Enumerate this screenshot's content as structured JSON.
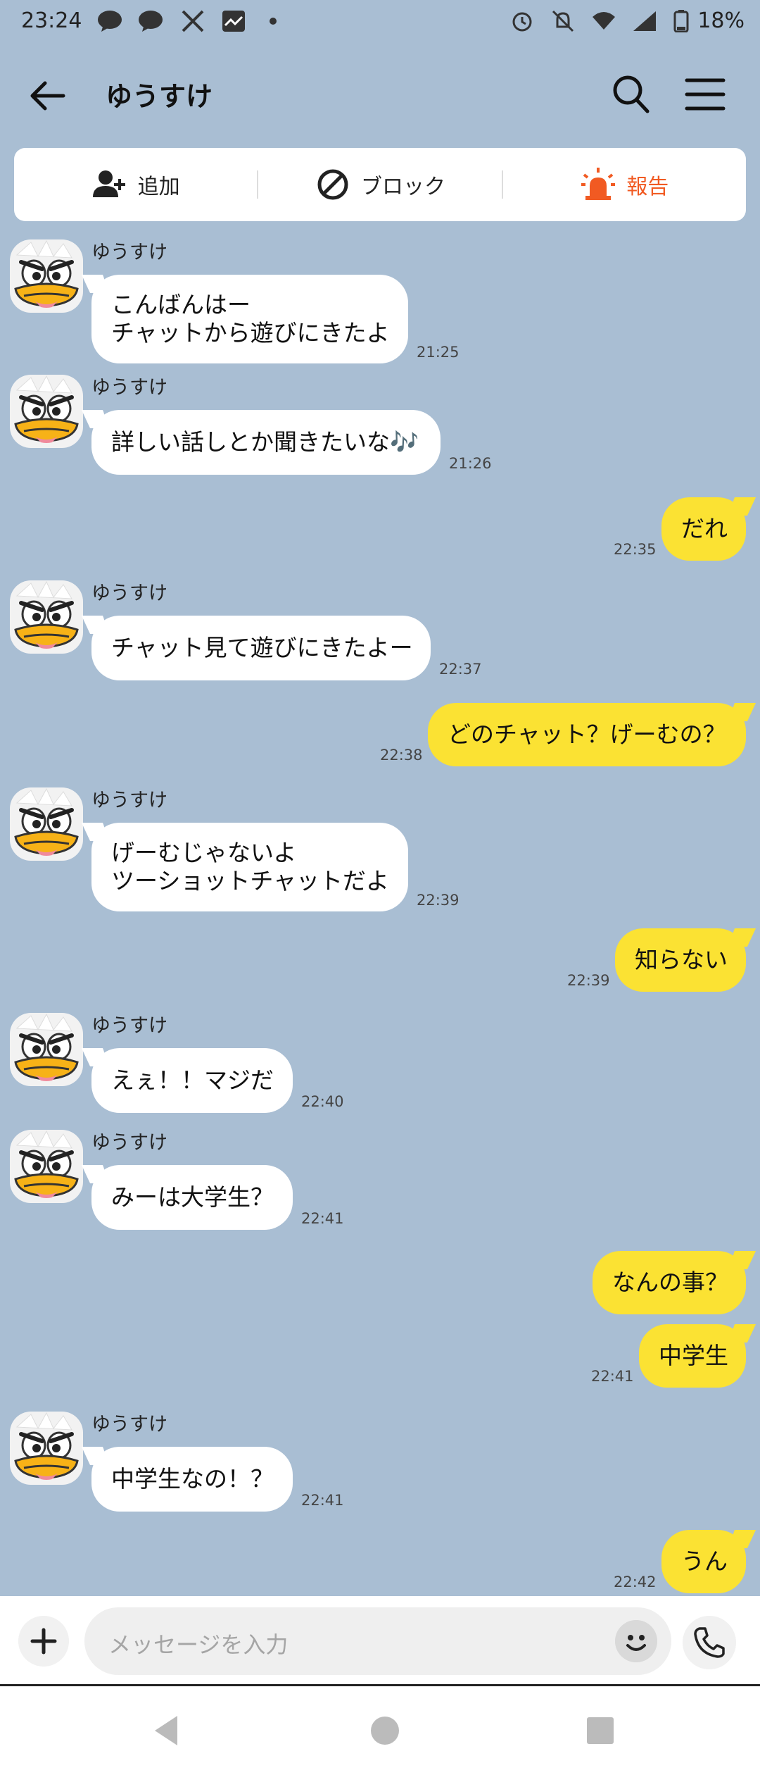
{
  "status_bar": {
    "time": "23:24",
    "notifications": [
      "talk-icon",
      "talk-icon",
      "x-icon",
      "gallery-icon",
      "dot-icon"
    ],
    "battery": "18%"
  },
  "header": {
    "title": "ゆうすけ"
  },
  "actions": {
    "add": "追加",
    "block": "ブロック",
    "report": "報告"
  },
  "messages": [
    {
      "side": "in",
      "sender": "ゆうすけ",
      "text": "こんばんはー\nチャットから遊びにきたよ",
      "time": "21:25"
    },
    {
      "side": "in",
      "sender": "ゆうすけ",
      "text": "詳しい話しとか聞きたいな🎶",
      "time": "21:26"
    },
    {
      "side": "out",
      "text": "だれ",
      "time": "22:35"
    },
    {
      "side": "in",
      "sender": "ゆうすけ",
      "text": "チャット見て遊びにきたよー",
      "time": "22:37"
    },
    {
      "side": "out",
      "text": "どのチャット？げーむの？",
      "time": "22:38"
    },
    {
      "side": "in",
      "sender": "ゆうすけ",
      "text": "げーむじゃないよ\nツーショットチャットだよ",
      "time": "22:39"
    },
    {
      "side": "out",
      "text": "知らない",
      "time": "22:39"
    },
    {
      "side": "in",
      "sender": "ゆうすけ",
      "text": "えぇ！！マジだ",
      "time": "22:40"
    },
    {
      "side": "in",
      "sender": "ゆうすけ",
      "text": "みーは大学生？",
      "time": "22:41"
    },
    {
      "side": "out",
      "text": "なんの事？",
      "time": ""
    },
    {
      "side": "out",
      "text": "中学生",
      "time": "22:41"
    },
    {
      "side": "in",
      "sender": "ゆうすけ",
      "text": "中学生なの！？",
      "time": "22:41"
    },
    {
      "side": "out",
      "text": "うん",
      "time": "22:42"
    }
  ],
  "input": {
    "placeholder": "メッセージを入力"
  },
  "colors": {
    "background": "#a9bed3",
    "outgoing_bubble": "#fbe233",
    "incoming_bubble": "#ffffff",
    "report_accent": "#f15a22"
  }
}
